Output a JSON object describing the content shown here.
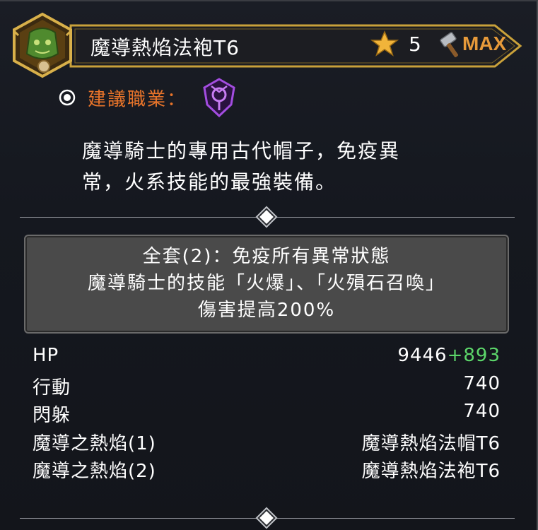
{
  "item": {
    "title": "魔導熱焰法袍T6",
    "stars": "5",
    "enhance_label": "MAX",
    "icon": "green-robe-item-icon"
  },
  "recommended": {
    "label": "建議職業：",
    "class_icon": "magic-knight-class-icon"
  },
  "description": {
    "line1": "魔導騎士的專用古代帽子，免疫異",
    "line2": "常，火系技能的最強裝備。"
  },
  "set_bonus": {
    "line1": "全套(2)：免疫所有異常狀態",
    "line2": "魔導騎士的技能「火爆」、「火殞石召喚」",
    "line3": "傷害提高200%"
  },
  "stats": [
    {
      "name": "HP",
      "value": "9446",
      "bonus": "+893"
    },
    {
      "name": "行動",
      "value": "740",
      "bonus": ""
    },
    {
      "name": "閃躲",
      "value": "740",
      "bonus": ""
    },
    {
      "name": "魔導之熱焰(1)",
      "value": "魔導熱焰法帽T6",
      "bonus": ""
    },
    {
      "name": "魔導之熱焰(2)",
      "value": "魔導熱焰法袍T6",
      "bonus": ""
    }
  ],
  "colors": {
    "frame_gold": "#c9a13a",
    "max_orange": "#e79a3a",
    "class_label_orange": "#e8742a",
    "bonus_green": "#5cd66a"
  }
}
